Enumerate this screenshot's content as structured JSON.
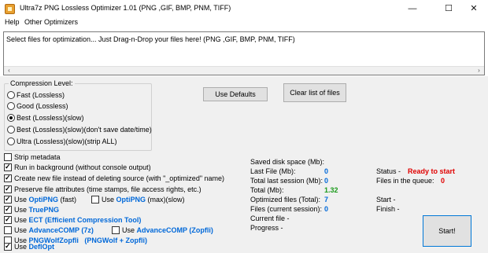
{
  "window": {
    "title": "Ultra7z PNG Lossless Optimizer 1.01 (PNG ,GIF, BMP, PNM, TIFF)",
    "icon": "app-icon",
    "minimize": "—",
    "maximize": "☐",
    "close": "✕"
  },
  "menu": {
    "items": [
      "Help",
      "Other Optimizers"
    ]
  },
  "dropzone": {
    "text": "Select files for optimization... Just Drag-n-Drop your files here! (PNG ,GIF, BMP, PNM, TIFF)"
  },
  "compression": {
    "title": "Compression Level:",
    "options": [
      {
        "label": "Fast (Lossless)",
        "selected": false
      },
      {
        "label": "Good (Lossless)",
        "selected": false
      },
      {
        "label": "Best (Lossless)(slow)",
        "selected": true
      },
      {
        "label": "Best (Lossless)(slow)(don't save date/time)",
        "selected": false
      },
      {
        "label": "Ultra (Lossless)(slow)(strip ALL)",
        "selected": false
      }
    ]
  },
  "buttons": {
    "defaults": "Use Defaults",
    "clear": "Clear list of files",
    "start": "Start!"
  },
  "options": {
    "strip_metadata": {
      "label": "Strip metadata",
      "checked": false
    },
    "background": {
      "label": "Run in background (without console output)",
      "checked": true
    },
    "new_file": {
      "label": "Create new file instead of deleting source (with \"_optimized\" name)",
      "checked": true
    },
    "preserve": {
      "label": "Preserve file attributes (time stamps, file access rights, etc.)",
      "checked": true
    },
    "use": "Use",
    "optipng_fast": {
      "name": "OptiPNG",
      "suffix": "(fast)",
      "checked": true
    },
    "optipng_max": {
      "name": "OptiPNG",
      "suffix": "(max)(slow)",
      "checked": false
    },
    "truepng": {
      "name": "TruePNG",
      "checked": true
    },
    "ect": {
      "name": "ECT (Efficient Compression Tool)",
      "checked": true
    },
    "advcomp_7z": {
      "name": "AdvanceCOMP (7z)",
      "checked": false
    },
    "advcomp_zopfli": {
      "name": "AdvanceCOMP (Zopfli)",
      "checked": false
    },
    "pngwolf": {
      "name": "PNGWolfZopfli",
      "suffix": "(PNGWolf + Zopfli)",
      "checked": false
    },
    "deflopt": {
      "name": "DeflOpt",
      "checked": true
    }
  },
  "stats": {
    "saved_label": "Saved disk space (Mb):",
    "last_file_label": "Last File (Mb):",
    "last_file_value": "0",
    "total_session_label": "Total last session (Mb):",
    "total_session_value": "0",
    "total_label": "Total (Mb):",
    "total_value": "1.32",
    "optimized_label": "Optimized files (Total):",
    "optimized_value": "7",
    "files_session_label": "Files (current session):",
    "files_session_value": "0",
    "current_file_label": "Current file -",
    "progress_label": "Progress -",
    "status_label": "Status -",
    "status_value": "Ready to start",
    "queue_label": "Files in the queue:",
    "queue_value": "0",
    "start_label": "Start -",
    "finish_label": "Finish -"
  },
  "colors": {
    "accent_blue": "#0068d9",
    "green": "#1a9a1a",
    "red": "#e00000"
  }
}
